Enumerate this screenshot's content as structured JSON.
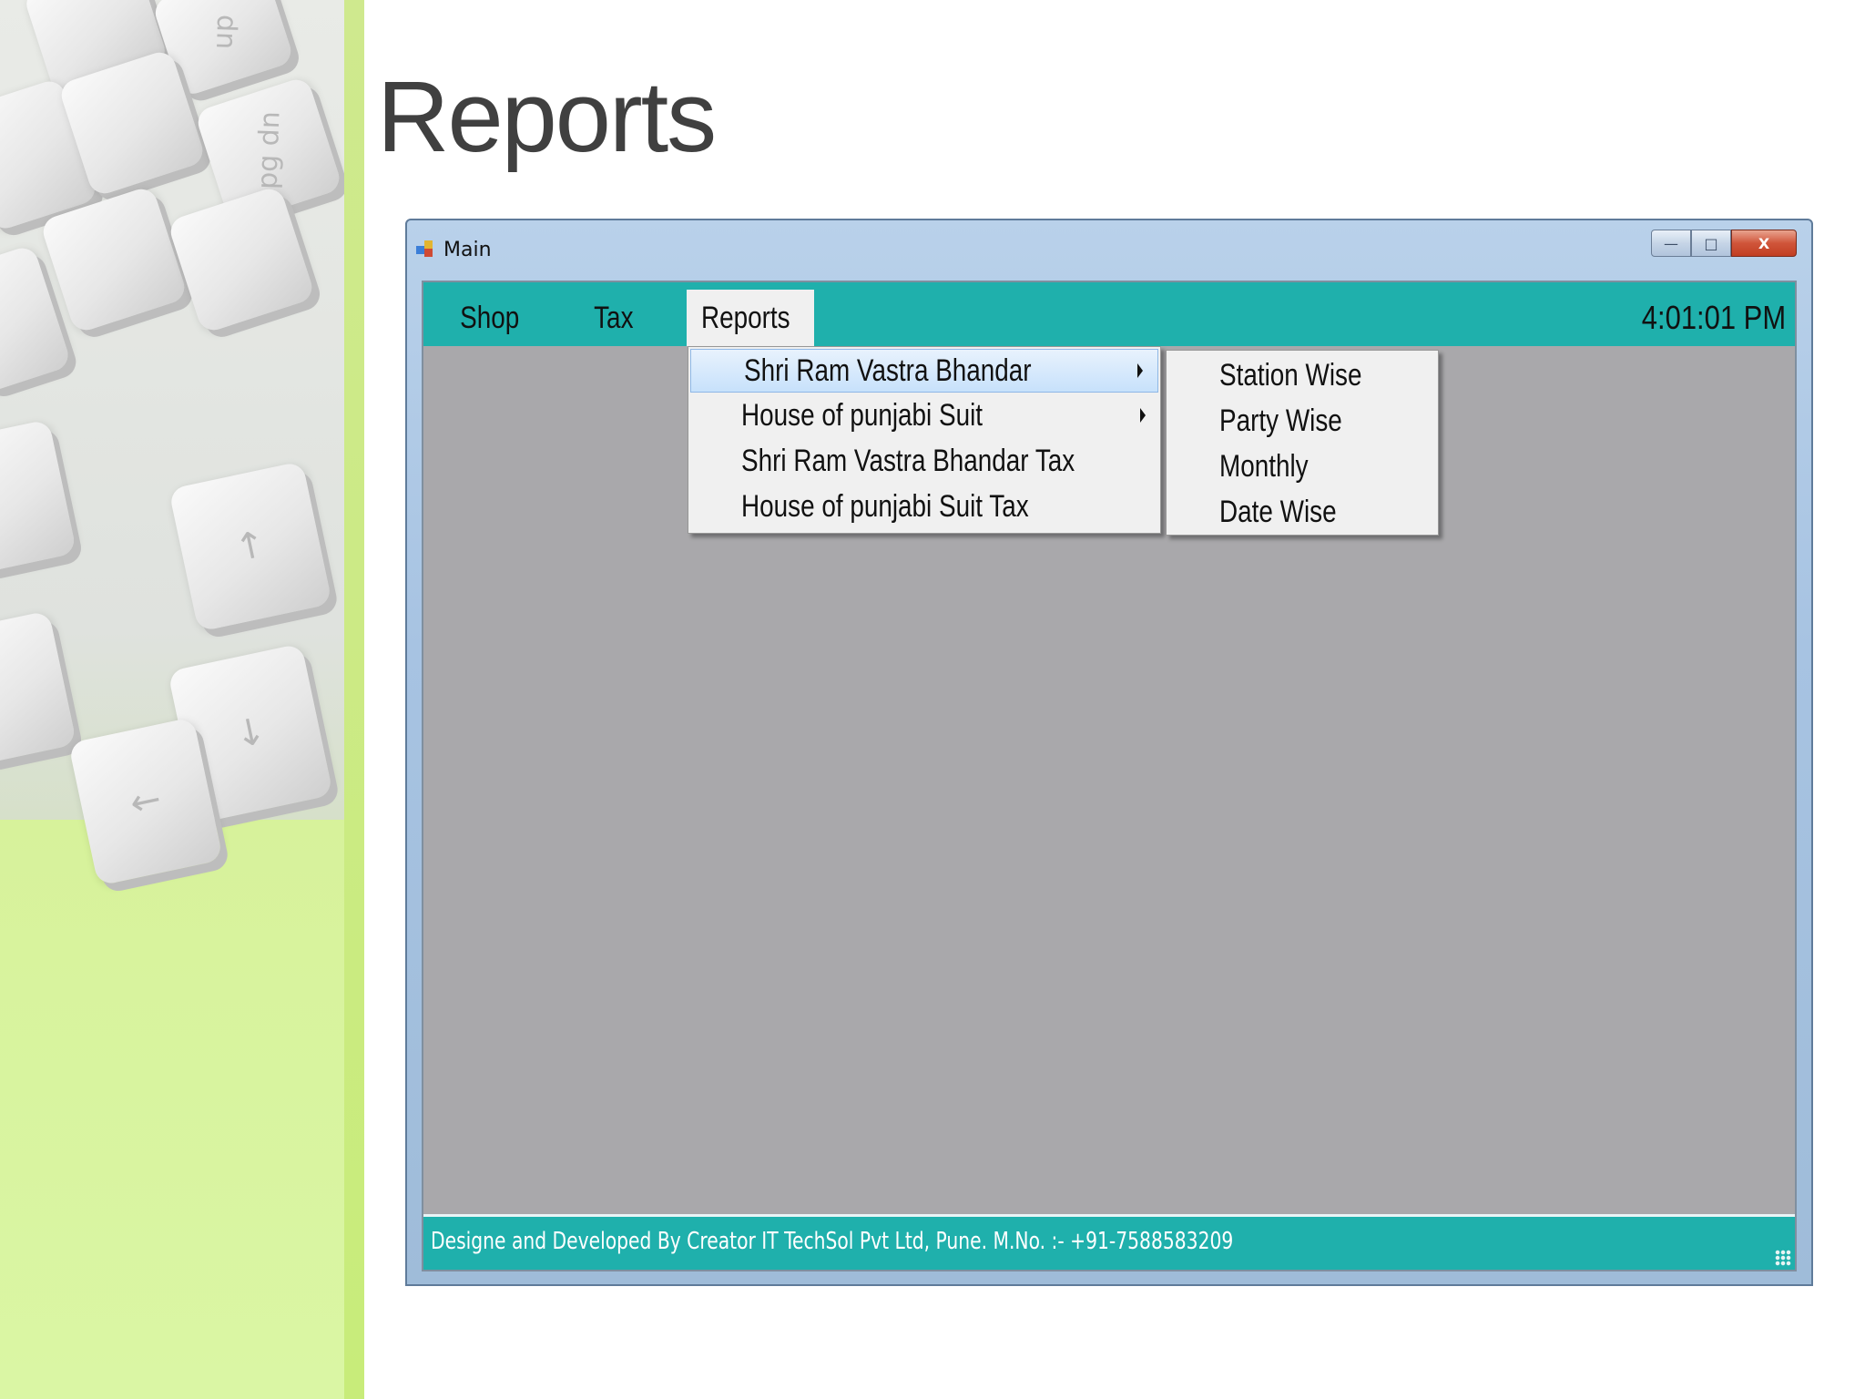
{
  "slide": {
    "title": "Reports"
  },
  "window": {
    "title": "Main",
    "controls": {
      "minimize": "—",
      "maximize": "□",
      "close": "X"
    }
  },
  "menubar": {
    "items": [
      {
        "label": "Shop"
      },
      {
        "label": "Tax"
      },
      {
        "label": "Reports"
      }
    ],
    "clock": "4:01:01 PM"
  },
  "reports_menu": {
    "items": [
      {
        "label": "Shri Ram Vastra Bhandar",
        "has_submenu": true,
        "highlighted": true
      },
      {
        "label": "House of punjabi Suit",
        "has_submenu": true
      },
      {
        "label": "Shri Ram Vastra Bhandar Tax"
      },
      {
        "label": "House of punjabi Suit Tax"
      }
    ]
  },
  "submenu": {
    "items": [
      {
        "label": "Station Wise"
      },
      {
        "label": "Party Wise"
      },
      {
        "label": "Monthly"
      },
      {
        "label": "Date Wise"
      }
    ]
  },
  "statusbar": {
    "text": "Designe and Developed By Creator IT TechSol Pvt Ltd, Pune.    M.No. :- +91-7588583209"
  },
  "colors": {
    "teal": "#1fb0ac",
    "workspace": "#a9a8ab",
    "title": "#404040",
    "green_accent": "#c8ec7a"
  },
  "icons": {
    "app": "app-window-icon",
    "submenu_arrow": "chevron-right-icon",
    "resize": "resize-grip-icon"
  }
}
